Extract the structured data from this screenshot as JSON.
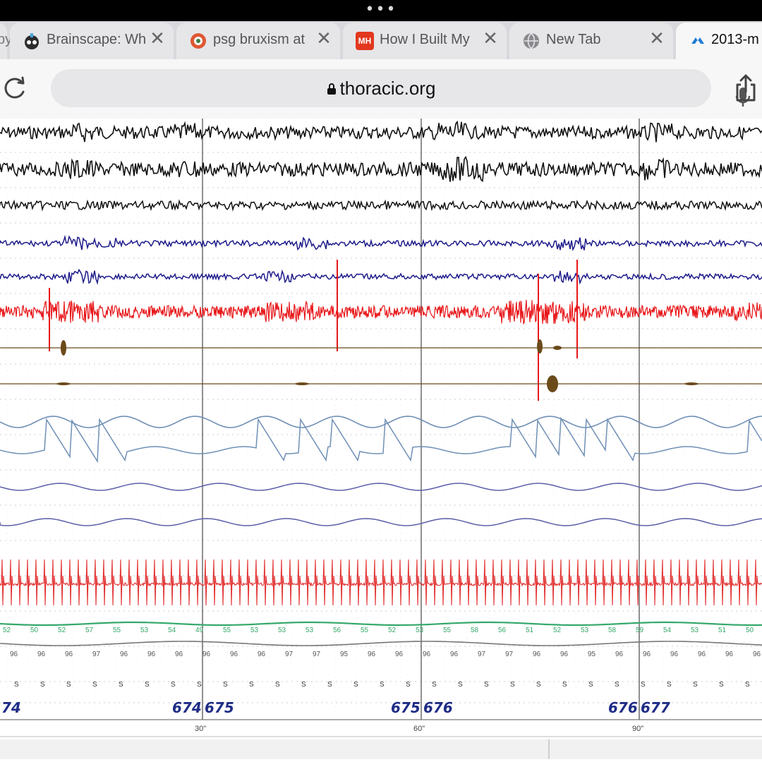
{
  "browser": {
    "grabber": "•••",
    "tabs": [
      {
        "title": "py",
        "icon": "page-icon",
        "close": ""
      },
      {
        "title": "Brainscape: Wh",
        "icon": "brainscape-icon",
        "close": "✕"
      },
      {
        "title": "psg bruxism at",
        "icon": "duckduckgo-icon",
        "close": "✕"
      },
      {
        "title": "How I Built My",
        "icon": "mh-icon",
        "icon_text": "MH",
        "close": "✕"
      },
      {
        "title": "New Tab",
        "icon": "globe-icon",
        "close": "✕"
      },
      {
        "title": "2013-m",
        "icon": "thoracic-icon",
        "active": true
      }
    ],
    "address": {
      "url": "thoracic.org",
      "lock_icon": "lock-icon"
    },
    "buttons": {
      "reload": "reload-icon",
      "mic": "mic-icon",
      "share": "share-icon"
    }
  },
  "recording": {
    "epoch_labels": [
      "74",
      "674",
      "675",
      "675",
      "676",
      "676",
      "677"
    ],
    "time_marks": [
      "30\"",
      "60\"",
      "90\""
    ],
    "spo2_values": [
      "52",
      "50",
      "52",
      "57",
      "55",
      "53",
      "54",
      "49",
      "55",
      "53",
      "53",
      "53",
      "56",
      "55",
      "52",
      "53",
      "55",
      "58",
      "56",
      "51",
      "52",
      "53",
      "58",
      "59",
      "54",
      "53",
      "51",
      "50"
    ],
    "pulse_values": [
      "96",
      "96",
      "96",
      "97",
      "96",
      "96",
      "96",
      "96",
      "96",
      "96",
      "97",
      "97",
      "95",
      "96",
      "96",
      "96",
      "96",
      "97",
      "97",
      "96",
      "96",
      "95",
      "96",
      "96",
      "96",
      "96",
      "96",
      "96"
    ],
    "position_values": [
      "S",
      "S",
      "S",
      "S",
      "S",
      "S",
      "S",
      "S",
      "S",
      "S",
      "S",
      "S",
      "S",
      "S",
      "S",
      "S",
      "S",
      "S",
      "S",
      "S",
      "S",
      "S",
      "S",
      "S",
      "S",
      "S",
      "S",
      "S",
      "S",
      "S"
    ],
    "colors": {
      "eeg": "#111111",
      "eog": "#1d1a8a",
      "emg": "#e8171a",
      "leg": "#6b4a1a",
      "flow": "#6f8fb5",
      "effort": "#5b5fa8",
      "ecg": "#e23030",
      "spo2": "#35a86a",
      "pulse": "#777777",
      "epoch": "#1f2d86"
    }
  }
}
